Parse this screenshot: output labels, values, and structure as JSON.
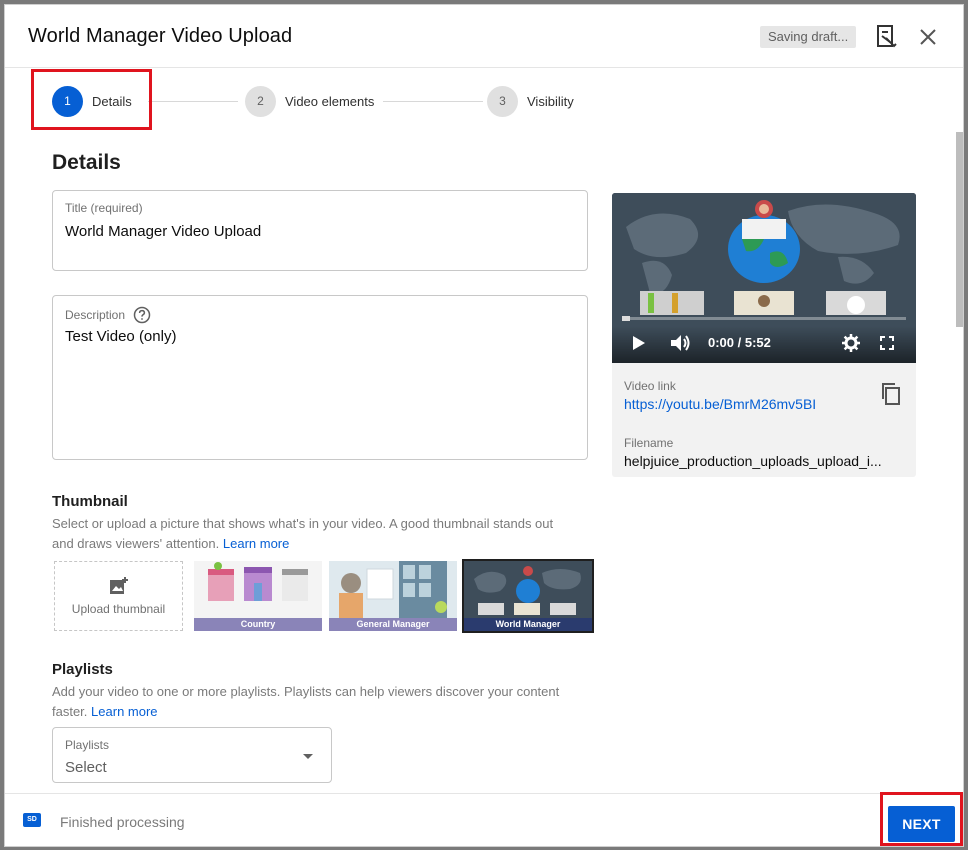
{
  "dialog": {
    "title": "World Manager Video Upload",
    "saving_status": "Saving draft..."
  },
  "stepper": {
    "steps": [
      {
        "number": "1",
        "label": "Details",
        "active": true
      },
      {
        "number": "2",
        "label": "Video elements",
        "active": false
      },
      {
        "number": "3",
        "label": "Visibility",
        "active": false
      }
    ]
  },
  "details": {
    "section_title": "Details",
    "title_field": {
      "label": "Title (required)",
      "value": "World Manager Video Upload"
    },
    "description_field": {
      "label": "Description",
      "value": "Test Video (only)"
    }
  },
  "thumbnail": {
    "heading": "Thumbnail",
    "description": "Select or upload a picture that shows what's in your video. A good thumbnail stands out and draws viewers' attention.",
    "learn_more": "Learn more",
    "upload_label": "Upload thumbnail",
    "options": [
      {
        "caption": "Country",
        "selected": false
      },
      {
        "caption": "General Manager",
        "selected": false
      },
      {
        "caption": "World Manager",
        "selected": true
      }
    ]
  },
  "playlists": {
    "heading": "Playlists",
    "description": "Add your video to one or more playlists. Playlists can help viewers discover your content faster.",
    "learn_more": "Learn more",
    "select_label": "Playlists",
    "select_value": "Select"
  },
  "preview": {
    "time": "0:00 / 5:52",
    "progress": 0.0,
    "video_link_label": "Video link",
    "video_link": "https://youtu.be/BmrM26mv5BI",
    "filename_label": "Filename",
    "filename": "helpjuice_production_uploads_upload_i..."
  },
  "footer": {
    "badge": "SD",
    "status": "Finished processing",
    "next_label": "NEXT"
  },
  "colors": {
    "accent": "#065fd4",
    "highlight": "#e0141e"
  }
}
